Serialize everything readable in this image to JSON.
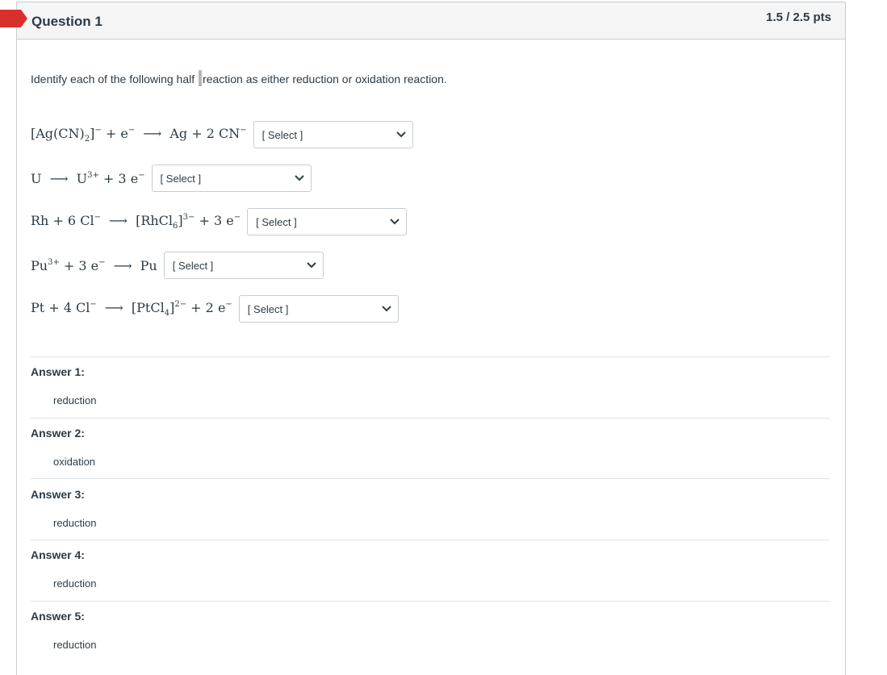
{
  "header": {
    "title": "Question 1",
    "points": "1.5 / 2.5 pts"
  },
  "prompt": {
    "before_cursor": "Identify each of the following half ",
    "after_cursor": "reaction as either reduction or oxidation reaction."
  },
  "reactions": [
    {
      "select_placeholder": "[ Select ]"
    },
    {
      "select_placeholder": "[ Select ]"
    },
    {
      "select_placeholder": "[ Select ]"
    },
    {
      "select_placeholder": "[ Select ]"
    },
    {
      "select_placeholder": "[ Select ]"
    }
  ],
  "answers": [
    {
      "label": "Answer 1:",
      "value": "reduction"
    },
    {
      "label": "Answer 2:",
      "value": "oxidation"
    },
    {
      "label": "Answer 3:",
      "value": "reduction"
    },
    {
      "label": "Answer 4:",
      "value": "reduction"
    },
    {
      "label": "Answer 5:",
      "value": "reduction"
    }
  ],
  "colors": {
    "flag": "#d9302c",
    "border": "#c7cdd1",
    "text": "#2d3b45"
  },
  "icons": {
    "flag": "flag-icon",
    "dropdown": "chevron-down-icon"
  }
}
